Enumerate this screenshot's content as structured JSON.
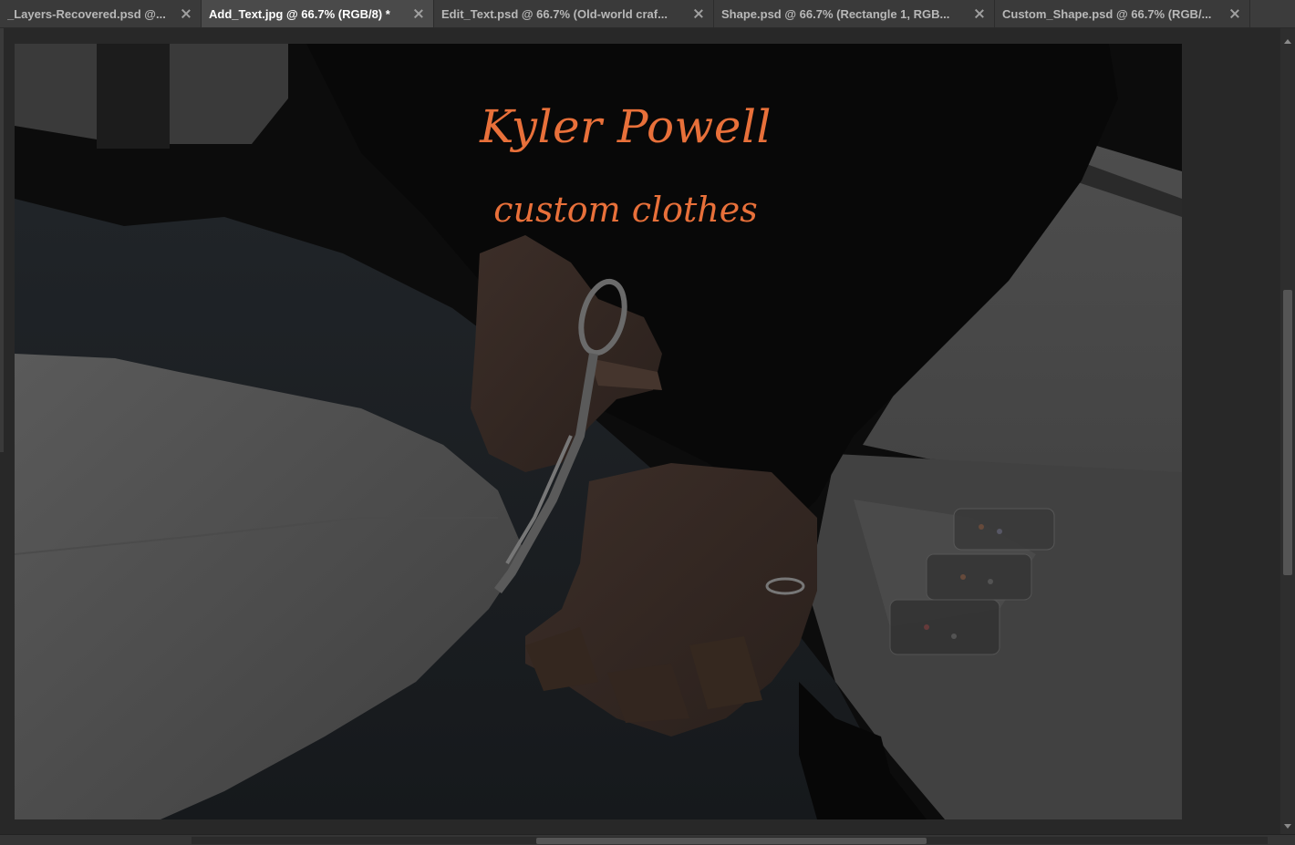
{
  "tabs": [
    {
      "label": "_Layers-Recovered.psd @...",
      "active": false
    },
    {
      "label": "Add_Text.jpg @ 66.7% (RGB/8) *",
      "active": true
    },
    {
      "label": "Edit_Text.psd @ 66.7% (Old-world craf...",
      "active": false
    },
    {
      "label": "Shape.psd @ 66.7% (Rectangle 1, RGB...",
      "active": false
    },
    {
      "label": "Custom_Shape.psd @ 66.7% (RGB/...",
      "active": false
    }
  ],
  "canvas": {
    "title": "Kyler Powell",
    "subtitle": "custom clothes",
    "text_color": "#e8703a"
  },
  "colors": {
    "app_background": "#282828",
    "tab_bar": "#3c3c3c",
    "active_tab": "#4a4a4a"
  }
}
